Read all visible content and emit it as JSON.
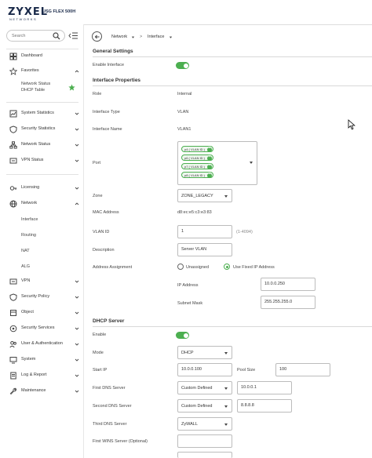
{
  "brand": {
    "logo": "ZYXEL",
    "logo_sub": "NETWORKS",
    "model": "USG FLEX 500H"
  },
  "colors": {
    "accent": "#4caf50",
    "brand_navy": "#1a2a4a"
  },
  "sidebar": {
    "search_placeholder": "Search",
    "items": [
      {
        "label": "Dashboard",
        "icon": "dashboard-icon"
      },
      {
        "label": "Favorites",
        "icon": "star-icon"
      },
      {
        "label": "System Statistics",
        "icon": "chart-icon"
      },
      {
        "label": "Security Statistics",
        "icon": "shield-chart-icon"
      },
      {
        "label": "Network Status",
        "icon": "network-icon"
      },
      {
        "label": "VPN Status",
        "icon": "vpn-icon"
      },
      {
        "label": "Licensing",
        "icon": "license-icon"
      },
      {
        "label": "Network",
        "icon": "globe-icon"
      },
      {
        "label": "VPN",
        "icon": "vpn-icon"
      },
      {
        "label": "Security Policy",
        "icon": "policy-icon"
      },
      {
        "label": "Object",
        "icon": "object-icon"
      },
      {
        "label": "Security Services",
        "icon": "services-icon"
      },
      {
        "label": "User & Authentication",
        "icon": "users-icon"
      },
      {
        "label": "System",
        "icon": "system-icon"
      },
      {
        "label": "Log & Report",
        "icon": "log-icon"
      },
      {
        "label": "Maintenance",
        "icon": "wrench-icon"
      }
    ],
    "favorites_sub": [
      "Network Status",
      "DHCP Table"
    ],
    "network_sub": [
      "Interface",
      "Routing",
      "NAT",
      "ALG"
    ]
  },
  "breadcrumb": {
    "level1": "Network",
    "level2": "Interface"
  },
  "general": {
    "title": "General Settings",
    "enable_label": "Enable Interface"
  },
  "props": {
    "title": "Interface Properties",
    "role_label": "Role",
    "role_value": "Internal",
    "type_label": "Interface Type",
    "type_value": "VLAN",
    "name_label": "Interface Name",
    "name_value": "VLAN1",
    "port_label": "Port",
    "ports": [
      "p4 ( VLAN ID )",
      "p6 ( VLAN ID )",
      "p7 ( VLAN ID )",
      "p8 ( VLAN ID )"
    ],
    "zone_label": "Zone",
    "zone_value": "ZONE_LEGACY",
    "mac_label": "MAC Address",
    "mac_value": "d8:ec:e5:c3:e3:83",
    "vlan_label": "VLAN ID",
    "vlan_value": "1",
    "vlan_hint": "(1-4094)",
    "desc_label": "Description",
    "desc_value": "Server VLAN",
    "addr_label": "Address Assignment",
    "addr_opt1": "Unassigned",
    "addr_opt2": "Use Fixed IP Address",
    "ip_label": "IP Address",
    "ip_value": "10.0.0.250",
    "mask_label": "Subnet Mask",
    "mask_value": "255.255.255.0"
  },
  "dhcp": {
    "title": "DHCP Server",
    "enable_label": "Enable",
    "mode_label": "Mode",
    "mode_value": "DHCP",
    "start_label": "Start IP",
    "start_value": "10.0.0.100",
    "pool_label": "Pool Size",
    "pool_value": "100",
    "dns1_label": "First DNS Server",
    "dns1_mode": "Custom Defined",
    "dns1_value": "10.0.0.1",
    "dns2_label": "Second DNS Server",
    "dns2_mode": "Custom Defined",
    "dns2_value": "8.8.8.8",
    "dns3_label": "Third DNS Server",
    "dns3_mode": "ZyWALL",
    "wins_label": "First WINS Server (Optional)"
  }
}
